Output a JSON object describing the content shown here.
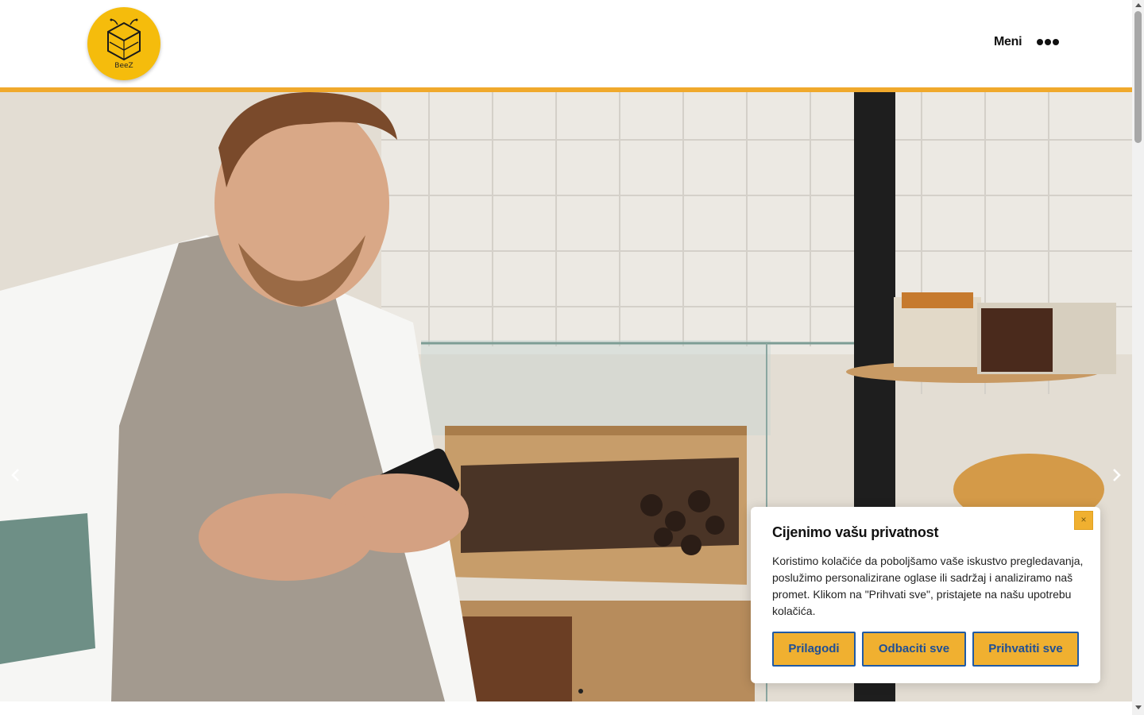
{
  "header": {
    "logo_text": "BeeZ",
    "menu_label": "Meni",
    "icons": {
      "menu": "ellipsis-icon",
      "logo": "bee-hexagon-logo"
    }
  },
  "hero": {
    "slider": {
      "prev_icon": "chevron-left-icon",
      "next_icon": "chevron-right-icon",
      "slide_count": 1,
      "active_slide": 1
    }
  },
  "cookie_banner": {
    "title": "Cijenimo vašu privatnost",
    "text": "Koristimo kolačiće da poboljšamo vaše iskustvo pregledavanja, poslužimo personalizirane oglase ili sadržaj i analiziramo naš promet. Klikom na \"Prihvati sve\", pristajete na našu upotrebu kolačića.",
    "close_symbol": "×",
    "buttons": {
      "customize": "Prilagodi",
      "reject": "Odbaciti sve",
      "accept": "Prihvatiti sve"
    }
  },
  "colors": {
    "accent": "#f0a92c",
    "logo_yellow": "#f5bc0c",
    "button_fill": "#f0b030",
    "button_border": "#1f5aa6"
  }
}
